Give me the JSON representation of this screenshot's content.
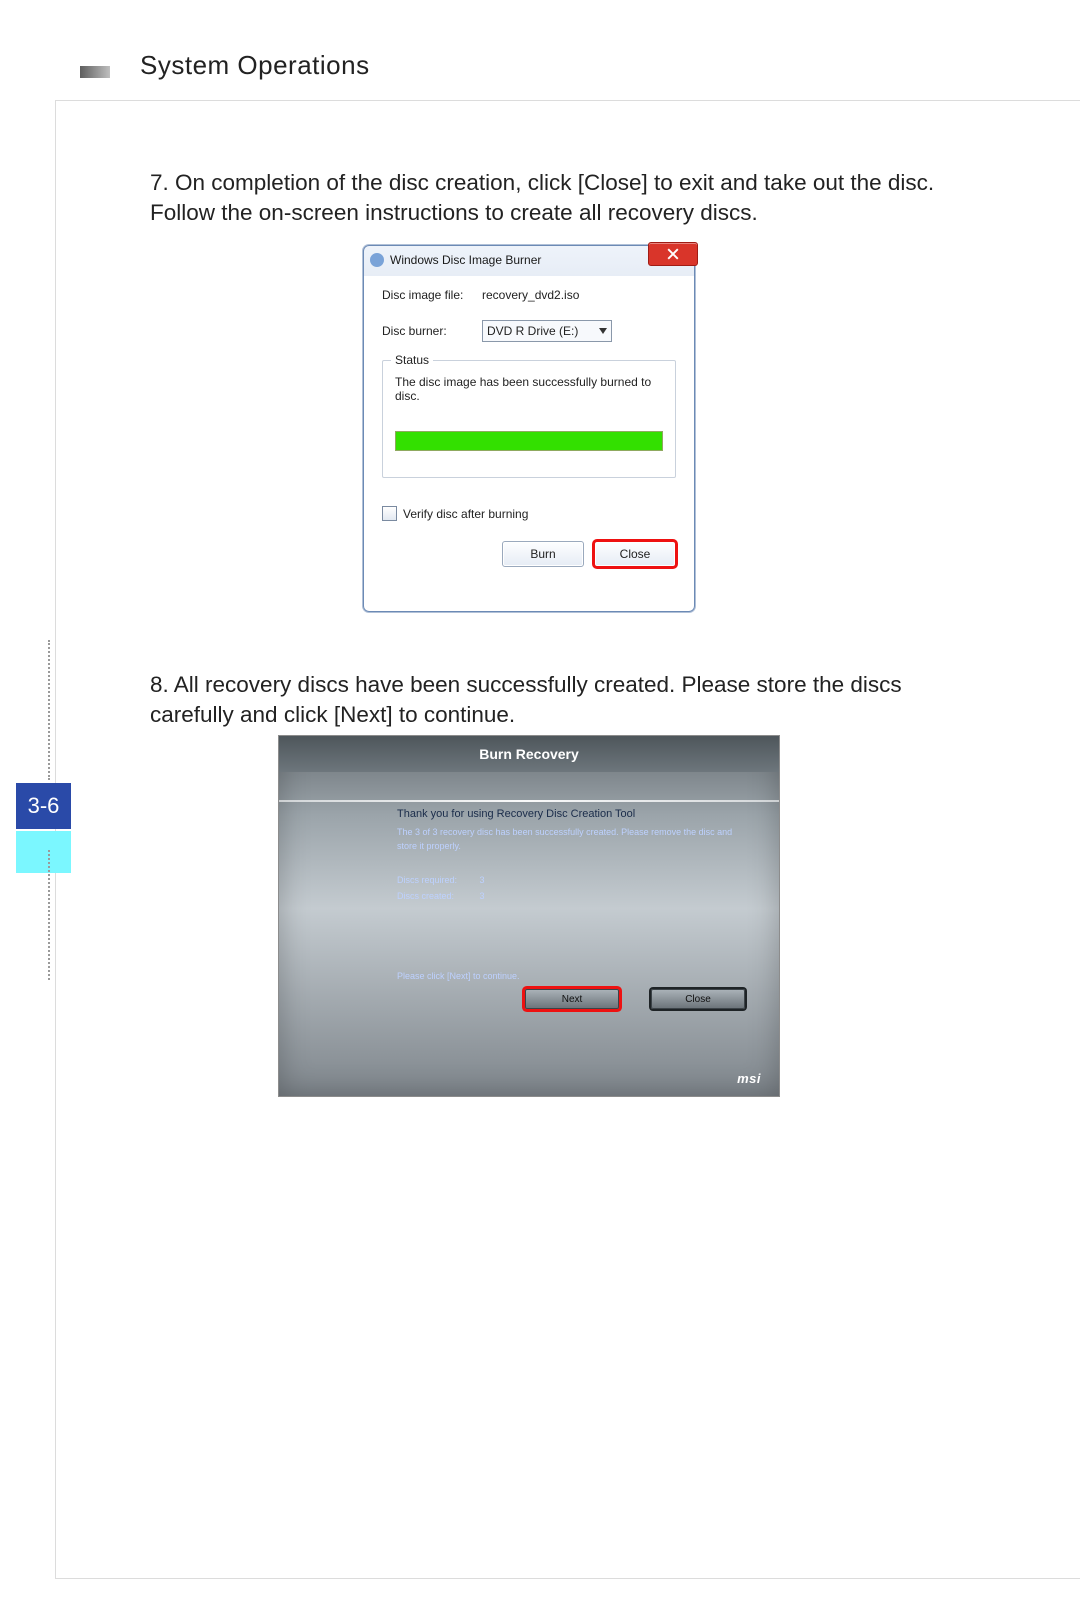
{
  "header": {
    "title": "System Operations"
  },
  "page_number": "3-6",
  "steps": {
    "s7": "7.  On completion of the disc creation, click [Close] to exit and take out the disc. Follow the on-screen instructions to create all recovery discs.",
    "s8": "8.  All recovery discs have been successfully created. Please store the discs carefully and click [Next] to continue."
  },
  "burner_dialog": {
    "title": "Windows Disc Image Burner",
    "file_label": "Disc image file:",
    "file_value": "recovery_dvd2.iso",
    "burner_label": "Disc burner:",
    "burner_value": "DVD R Drive (E:)",
    "status_label": "Status",
    "status_text": "The disc image has been successfully burned to disc.",
    "verify_label": "Verify disc after burning",
    "burn_btn": "Burn",
    "close_btn": "Close"
  },
  "recovery_dialog": {
    "title": "Burn Recovery",
    "thank": "Thank you for using Recovery Disc Creation Tool",
    "sub": "The 3 of 3 recovery disc has been successfully created. Please remove the disc and store it properly.",
    "req_label": "Discs required:",
    "req_val": "3",
    "created_label": "Discs created:",
    "created_val": "3",
    "cont": "Please click [Next] to continue.",
    "next_btn": "Next",
    "close_btn": "Close",
    "logo": "msi"
  }
}
